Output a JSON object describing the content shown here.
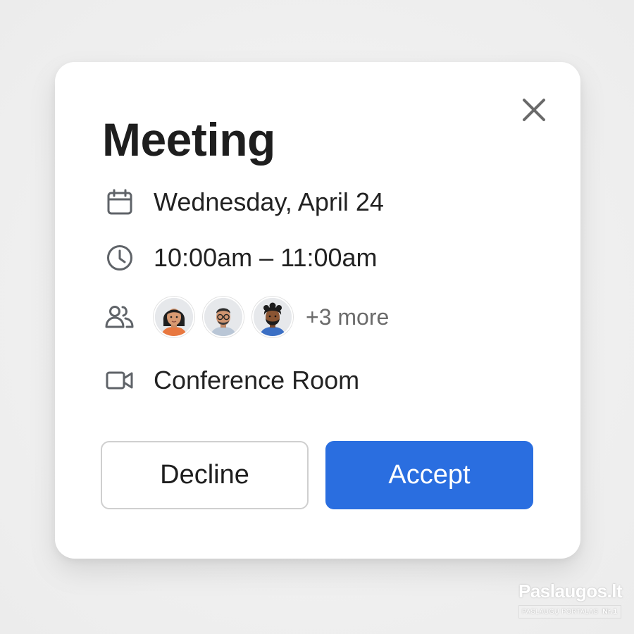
{
  "dialog": {
    "title": "Meeting",
    "close_icon": "close-icon"
  },
  "details": {
    "date": {
      "icon": "calendar-icon",
      "text": "Wednesday, April 24"
    },
    "time": {
      "icon": "clock-icon",
      "text": "10:00am – 11:00am"
    },
    "attendees": {
      "icon": "people-icon",
      "avatars": [
        "avatar-woman",
        "avatar-man-glasses",
        "avatar-man-beard"
      ],
      "more_label": "+3 more"
    },
    "location": {
      "icon": "video-camera-icon",
      "text": "Conference Room"
    }
  },
  "actions": {
    "decline_label": "Decline",
    "accept_label": "Accept"
  },
  "watermark": {
    "brand": "Paslaugos.lt",
    "tagline": "PASLAUGŲ PORTALAS",
    "rank": "Nr.1"
  },
  "colors": {
    "accent": "#2a6ee0",
    "text": "#1e1e1e",
    "icon": "#5f6368",
    "muted": "#6b6b6b"
  }
}
